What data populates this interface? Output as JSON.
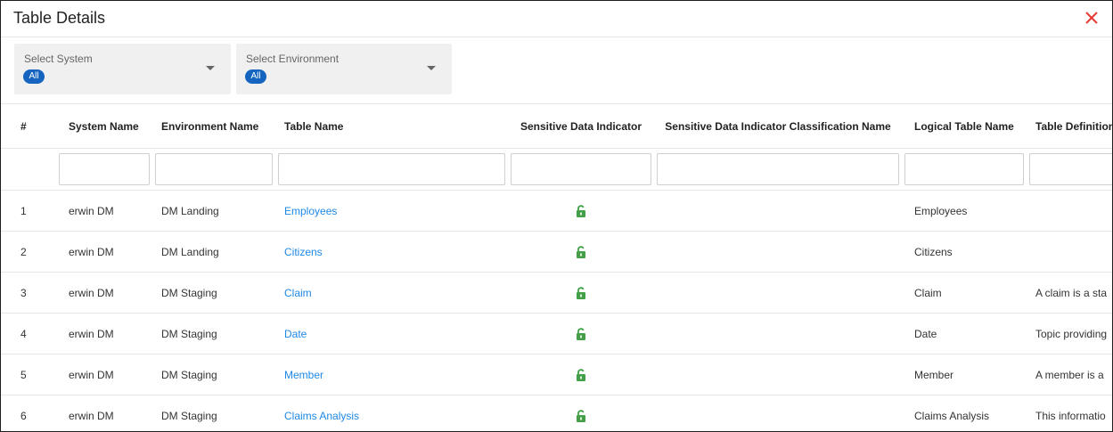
{
  "dialog": {
    "title": "Table Details",
    "close_icon": "close-icon"
  },
  "filters": {
    "system": {
      "label": "Select System",
      "selected": "All"
    },
    "environment": {
      "label": "Select Environment",
      "selected": "All"
    }
  },
  "table": {
    "headers": {
      "index": "#",
      "system": "System Name",
      "environment": "Environment Name",
      "table_name": "Table Name",
      "sdi": "Sensitive Data Indicator",
      "sdi_class": "Sensitive Data Indicator Classification Name",
      "logical": "Logical Table Name",
      "definition": "Table Definition"
    },
    "rows": [
      {
        "index": "1",
        "system": "erwin DM",
        "environment": "DM Landing",
        "table_name": "Employees",
        "logical": "Employees",
        "definition": ""
      },
      {
        "index": "2",
        "system": "erwin DM",
        "environment": "DM Landing",
        "table_name": "Citizens",
        "logical": "Citizens",
        "definition": ""
      },
      {
        "index": "3",
        "system": "erwin DM",
        "environment": "DM Staging",
        "table_name": "Claim",
        "logical": "Claim",
        "definition": "A claim is a sta"
      },
      {
        "index": "4",
        "system": "erwin DM",
        "environment": "DM Staging",
        "table_name": "Date",
        "logical": "Date",
        "definition": "Topic providing"
      },
      {
        "index": "5",
        "system": "erwin DM",
        "environment": "DM Staging",
        "table_name": "Member",
        "logical": "Member",
        "definition": "A member is a"
      },
      {
        "index": "6",
        "system": "erwin DM",
        "environment": "DM Staging",
        "table_name": "Claims Analysis",
        "logical": "Claims Analysis",
        "definition": "This informatio"
      }
    ],
    "sensitive_icon": "lock-icon"
  },
  "colors": {
    "close": "#e53935",
    "link": "#1e88e5",
    "chip": "#1565c0",
    "lock": "#43a047"
  }
}
